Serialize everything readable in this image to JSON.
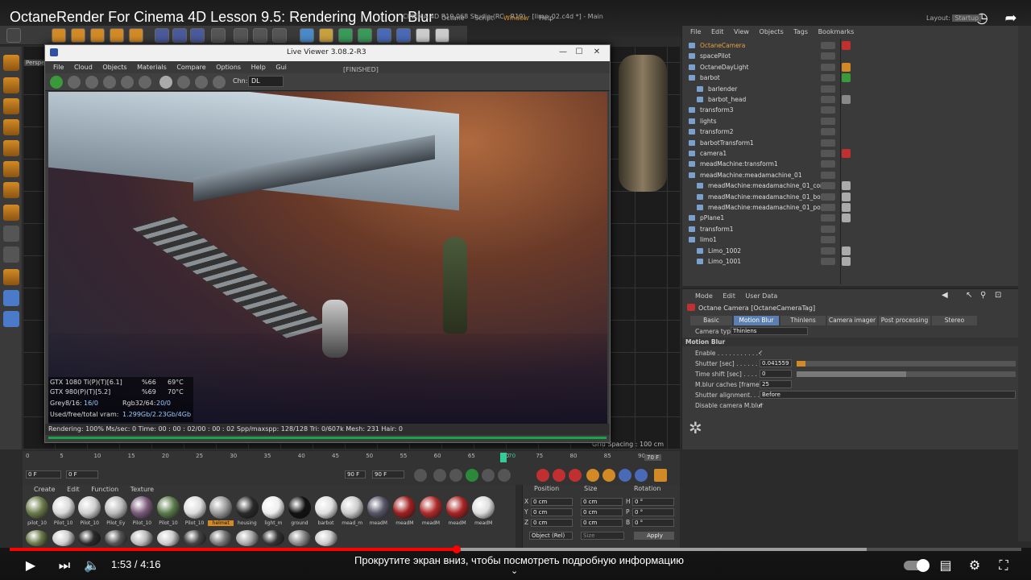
{
  "video": {
    "title": "OctaneRender For Cinema 4D Lesson 9.5: Rendering Motion Blur",
    "time_current": "1:53",
    "time_total": "4:16",
    "time_separator": " / ",
    "scroll_hint": "Прокрутите экран вниз, чтобы посмотреть подробную информацию",
    "progress_fraction": 0.442,
    "buffered_fraction": 0.847
  },
  "c4d": {
    "window_title": "CINEMA 4D R19.068 Studio (RC - R19) - [limo_02.c4d *] - Main",
    "menu": [
      "Octane",
      "Script",
      "Window",
      "Help"
    ],
    "layout_label": "Layout:",
    "layout_value": "Startup",
    "grid_spacing": "Grid Spacing : 100 cm",
    "viewport_label": "Perspe"
  },
  "live_viewer": {
    "title": "Live Viewer 3.08.2-R3",
    "status_tag": "[FINISHED]",
    "menu": [
      "File",
      "Cloud",
      "Objects",
      "Materials",
      "Compare",
      "Options",
      "Help",
      "Gui"
    ],
    "channel_label": "Chn:",
    "channel_value": "DL",
    "gpus": [
      {
        "name": "GTX 1080 Ti(P)(T)[6.1]",
        "load": "%66",
        "temp": "69°C"
      },
      {
        "name": "GTX 980(P)(T)[5.2]",
        "load": "%69",
        "temp": "70°C"
      }
    ],
    "grey_label": "Grey8/16:",
    "grey_value": "16/0",
    "rgb_label": "Rgb32/64:",
    "rgb_value": "20/0",
    "vram_label": "Used/free/total vram:",
    "vram_value": "1.299Gb/2.23Gb/4Gb",
    "status_bar": "Rendering: 100%  Ms/sec: 0    Time: 00 : 00 : 02/00 : 00 : 02   Spp/maxspp: 128/128    Tri: 0/607k   Mesh: 231    Hair: 0"
  },
  "object_manager": {
    "menu": [
      "File",
      "Edit",
      "View",
      "Objects",
      "Tags",
      "Bookmarks"
    ],
    "objects": [
      {
        "name": "OctaneCamera",
        "indent": 0,
        "highlight": true
      },
      {
        "name": "spacePilot",
        "indent": 0
      },
      {
        "name": "OctaneDayLight",
        "indent": 0
      },
      {
        "name": "barbot",
        "indent": 0
      },
      {
        "name": "barlender",
        "indent": 1
      },
      {
        "name": "barbot_head",
        "indent": 1
      },
      {
        "name": "transform3",
        "indent": 0
      },
      {
        "name": "lights",
        "indent": 0
      },
      {
        "name": "transform2",
        "indent": 0
      },
      {
        "name": "barbotTransform1",
        "indent": 0
      },
      {
        "name": "camera1",
        "indent": 0
      },
      {
        "name": "meadMachine:transform1",
        "indent": 0
      },
      {
        "name": "meadMachine:meadamachine_01",
        "indent": 0
      },
      {
        "name": "meadMachine:meadamachine_01_core",
        "indent": 1
      },
      {
        "name": "meadMachine:meadamachine_01_bowl",
        "indent": 1
      },
      {
        "name": "meadMachine:meadamachine_01_posts",
        "indent": 1
      },
      {
        "name": "pPlane1",
        "indent": 0
      },
      {
        "name": "transform1",
        "indent": 0
      },
      {
        "name": "limo1",
        "indent": 0
      },
      {
        "name": "Limo_1002",
        "indent": 1
      },
      {
        "name": "Limo_1001",
        "indent": 1
      }
    ]
  },
  "attribute_manager": {
    "menu": [
      "Mode",
      "Edit",
      "User Data"
    ],
    "title": "Octane Camera [OctaneCameraTag]",
    "tabs": [
      "Basic",
      "Motion Blur",
      "Thinlens",
      "Camera imager",
      "Post processing",
      "Stereo"
    ],
    "active_tab": "Motion Blur",
    "camera_type_label": "Camera type",
    "camera_type_value": "Thinlens",
    "section": "Motion Blur",
    "enable_label": "Enable . . . . . . . . . . . .",
    "enable_value": "✓",
    "shutter_label": "Shutter [sec] . . . . . . .",
    "shutter_value": "0.041559",
    "shutter_fraction": 0.04,
    "timeshift_label": "Time shift [sec] . . . . .",
    "timeshift_value": "0",
    "timeshift_fraction": 0.5,
    "mblur_caches_label": "M.blur caches [frame]",
    "mblur_caches_value": "25",
    "shutter_alignment_label": "Shutter alignment. . . . .",
    "shutter_alignment_value": "Before",
    "disable_mblur_label": "Disable camera M.blur",
    "disable_mblur_value": "✓"
  },
  "timeline": {
    "ticks": [
      "0",
      "5",
      "10",
      "15",
      "20",
      "25",
      "30",
      "35",
      "40",
      "45",
      "50",
      "55",
      "60",
      "65",
      "70",
      "75",
      "80",
      "85",
      "90"
    ],
    "current_frame": "70",
    "frame_readout": "70 F",
    "start_field": "0 F",
    "min_field": "0 F",
    "max_field": "90 F",
    "end_field": "90 F"
  },
  "material_manager": {
    "menu": [
      "Create",
      "Edit",
      "Function",
      "Texture"
    ],
    "materials_row1": [
      {
        "label": "pilot_10",
        "color": "#6b7a4a"
      },
      {
        "label": "Pilot_10",
        "color": "#d8d8d8"
      },
      {
        "label": "Pilot_10",
        "color": "#cfcfcf"
      },
      {
        "label": "Pilot_Ey",
        "color": "#bbbbbb"
      },
      {
        "label": "Pilot_10",
        "color": "#7a5a7a"
      },
      {
        "label": "Pilot_10",
        "color": "#5a7a4a"
      },
      {
        "label": "Pilot_10",
        "color": "#dddddd"
      },
      {
        "label": "helmet",
        "color": "#999999"
      },
      {
        "label": "housing",
        "color": "#2a2a2a"
      },
      {
        "label": "light_m",
        "color": "#eeeeee"
      },
      {
        "label": "ground",
        "color": "#111111"
      },
      {
        "label": "barbot",
        "color": "#e0e0e0"
      },
      {
        "label": "mead_m",
        "color": "#cccccc"
      },
      {
        "label": "meadM",
        "color": "#555566"
      },
      {
        "label": "meadM",
        "color": "#a02020"
      },
      {
        "label": "meadM",
        "color": "#b02a2a"
      },
      {
        "label": "meadM",
        "color": "#a82424"
      },
      {
        "label": "meadM",
        "color": "#dddddd"
      }
    ],
    "materials_row2_colors": [
      "#6b7a4a",
      "#d0d0d0",
      "#2a2a2a",
      "#555555",
      "#bbbbbb",
      "#cccccc",
      "#444444",
      "#777777",
      "#aaaaaa",
      "#333333",
      "#888888",
      "#cccccc"
    ]
  },
  "coordinates": {
    "headers": [
      "Position",
      "Size",
      "Rotation"
    ],
    "rows": [
      {
        "axis": "X",
        "pos": "0 cm",
        "size": "0 cm",
        "rot_axis": "H",
        "rot": "0 °"
      },
      {
        "axis": "Y",
        "pos": "0 cm",
        "size": "0 cm",
        "rot_axis": "P",
        "rot": "0 °"
      },
      {
        "axis": "Z",
        "pos": "0 cm",
        "size": "0 cm",
        "rot_axis": "B",
        "rot": "0 °"
      }
    ],
    "mode_value": "Object (Rel)",
    "size_mode_value": "Size",
    "apply_label": "Apply"
  },
  "colors": {
    "accent_orange": "#d28a26",
    "yt_red": "#ff0000",
    "progress_green": "#17a44a",
    "active_tab_blue": "#5b7fb0"
  }
}
